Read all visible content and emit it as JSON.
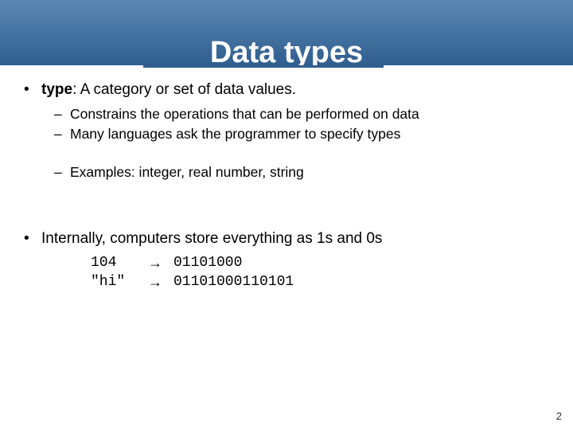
{
  "title": "Data types",
  "bullet1": {
    "term": "type",
    "colon_rest": ": A category or set of data values.",
    "subs": [
      "Constrains the operations that can be performed on data",
      "Many languages ask the programmer to specify types"
    ],
    "examples_sub": "Examples: integer, real number, string"
  },
  "bullet2": {
    "text": "Internally, computers store everything as 1s and 0s",
    "code": [
      {
        "key": "104",
        "arrow": "→",
        "val": "01101000"
      },
      {
        "key": "\"hi\"",
        "arrow": "→",
        "val": "01101000110101"
      }
    ]
  },
  "page_number": "2",
  "marks": {
    "bullet": "•",
    "dash": "–"
  }
}
